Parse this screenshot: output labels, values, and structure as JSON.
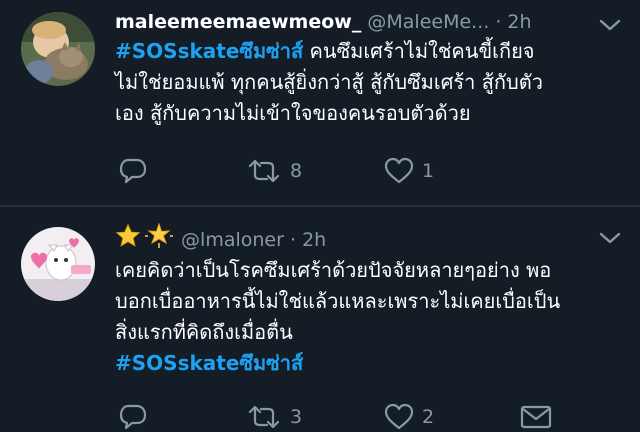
{
  "tweets": [
    {
      "display_name": "maleemeemaewmeow_",
      "handle": "@MaleeMe...",
      "sep": " · ",
      "time": "2h",
      "hashtag": "#SOSskateซึมซ่าส์",
      "lines": [
        " คนซึมเศร้าไม่ใช่คนขี้เกียจ",
        "ไม่ใช่ยอมแพ้ ทุกคนสู้ยิ่งกว่าสู้ สู้กับซึมเศร้า สู้กับตัว",
        "เอง สู้กับความไม่เข้าใจของคนรอบตัวด้วย"
      ],
      "retweets": "8",
      "likes": "1"
    },
    {
      "display_name_emoji": "⭐🌟",
      "handle": "@lmaloner",
      "sep": " · ",
      "time": "2h",
      "lines": [
        "เคยคิดว่าเป็นโรคซึมเศร้าด้วยปัจจัยหลายๆอย่าง พอ",
        "บอกเบื่ออาหารนี้ไม่ใช่แล้วแหละเพราะไม่เคยเบื่อเป็น",
        "สิ่งแรกที่คิดถึงเมื่อตื่น"
      ],
      "hashtag": "#SOSskateซึมซ่าส์",
      "retweets": "3",
      "likes": "2"
    }
  ],
  "icons": {
    "reply": "reply-icon",
    "retweet": "retweet-icon",
    "like": "heart-icon",
    "message": "envelope-icon",
    "more": "chevron-down-icon"
  },
  "colors": {
    "background": "#141d26",
    "hashtag": "#1da1f2",
    "muted": "#8899a6",
    "divider": "#28323c"
  }
}
